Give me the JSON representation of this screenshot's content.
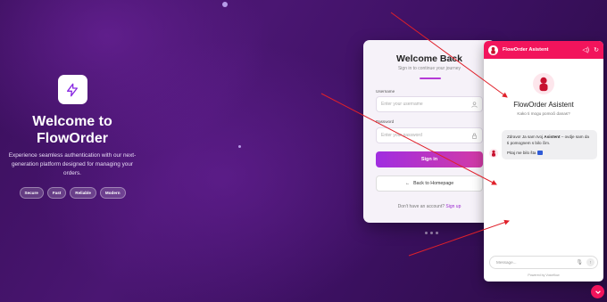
{
  "hero": {
    "title_line1": "Welcome to",
    "title_line2": "FlowOrder",
    "subtitle": "Experience seamless authentication with our next-generation platform designed for managing your orders.",
    "chips": [
      "Secure",
      "Fast",
      "Reliable",
      "Modern"
    ]
  },
  "login": {
    "title": "Welcome Back",
    "subtitle": "Sign in to continue your journey",
    "username_label": "Username",
    "username_placeholder": "Enter your username",
    "password_label": "Password",
    "password_placeholder": "Enter your password",
    "signin_label": "Sign in",
    "back_label": "Back to Homepage",
    "no_account_text": "Don't have an account?",
    "signup_label": "Sign up"
  },
  "chat": {
    "header_title": "FlowOrder Asistent",
    "bot_name": "FlowOrder Asistent",
    "ask_text": "Kako ti mogu pomoći danas?",
    "msg_part1": "Zdravo! Ja sam tvoj",
    "msg_bold": "Asistent",
    "msg_part2": "– ovdje sam da ti pomognem s bilo čim.",
    "msg_line2": "Pitaj me bilo šta",
    "input_placeholder": "Message...",
    "powered_by": "Powered by Voiceflow"
  },
  "colors": {
    "accent": "#f2145c",
    "signin_gradient_start": "#a02ee0",
    "signin_gradient_end": "#d33aa6",
    "annotation_arrows": "#e0202a"
  }
}
